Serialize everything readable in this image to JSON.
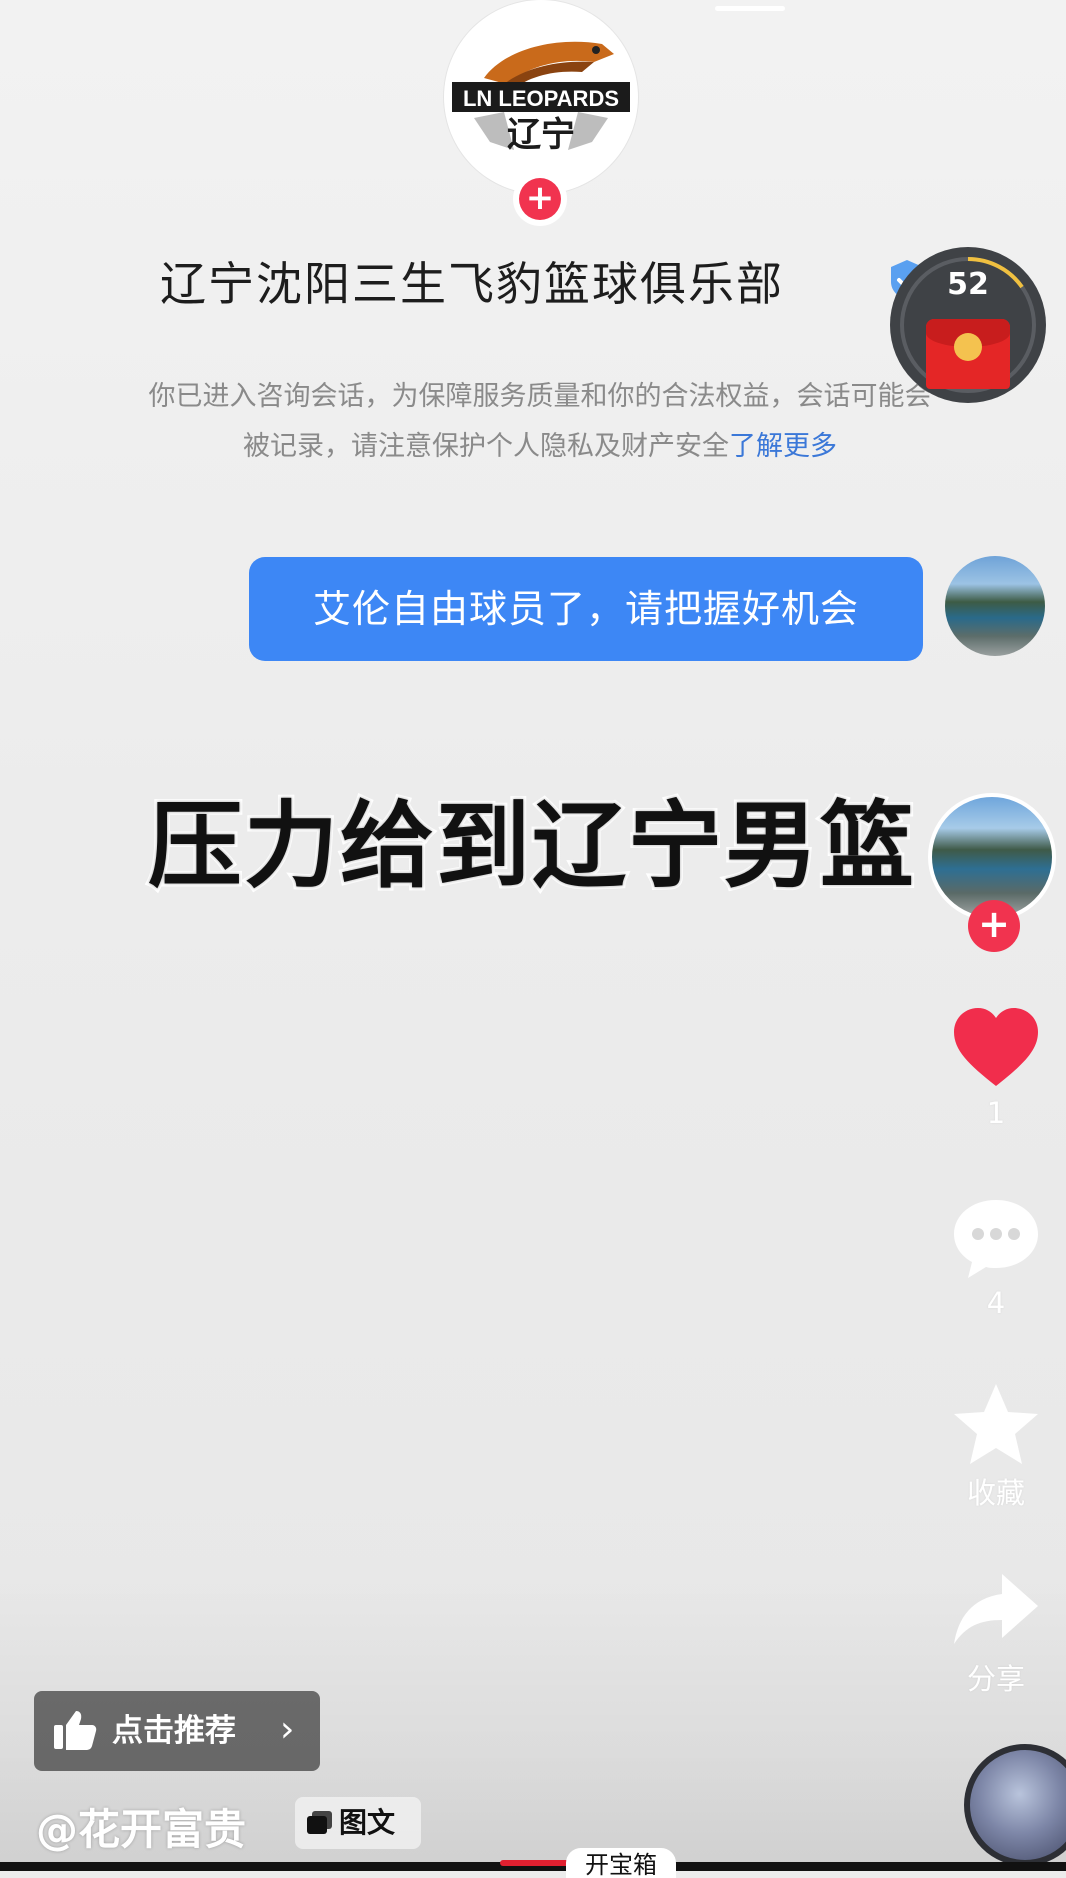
{
  "club": {
    "logo_text": "LN LEOPARDS",
    "logo_cn": "辽宁",
    "name": "辽宁沈阳三生飞豹篮球俱乐部",
    "follow_symbol": "+"
  },
  "notice": {
    "text": "你已进入咨询会话，为保障服务质量和你的合法权益，会话可能会被记录，请注意保护个人隐私及财产安全",
    "link": "了解更多"
  },
  "red_packet": {
    "count": "52",
    "icon": "red-envelope-icon"
  },
  "message": {
    "text": "艾伦自由球员了，请把握好机会"
  },
  "caption": {
    "text": "压力给到辽宁男篮"
  },
  "rail": {
    "creator_follow_symbol": "+",
    "like": {
      "icon": "heart-icon",
      "count": "1"
    },
    "comment": {
      "icon": "comment-icon",
      "count": "4"
    },
    "favorite": {
      "icon": "star-icon",
      "label": "收藏"
    },
    "share": {
      "icon": "share-icon",
      "label": "分享"
    }
  },
  "recommend": {
    "label": "点击推荐",
    "chevron": "›",
    "icon": "thumbs-up-icon"
  },
  "author": {
    "handle": "@花开富贵",
    "post_type": "图文"
  },
  "bottom": {
    "tag": "开宝箱"
  },
  "colors": {
    "bubble": "#3d87f5",
    "accent_red": "#f1334f",
    "link": "#3b78d8"
  }
}
